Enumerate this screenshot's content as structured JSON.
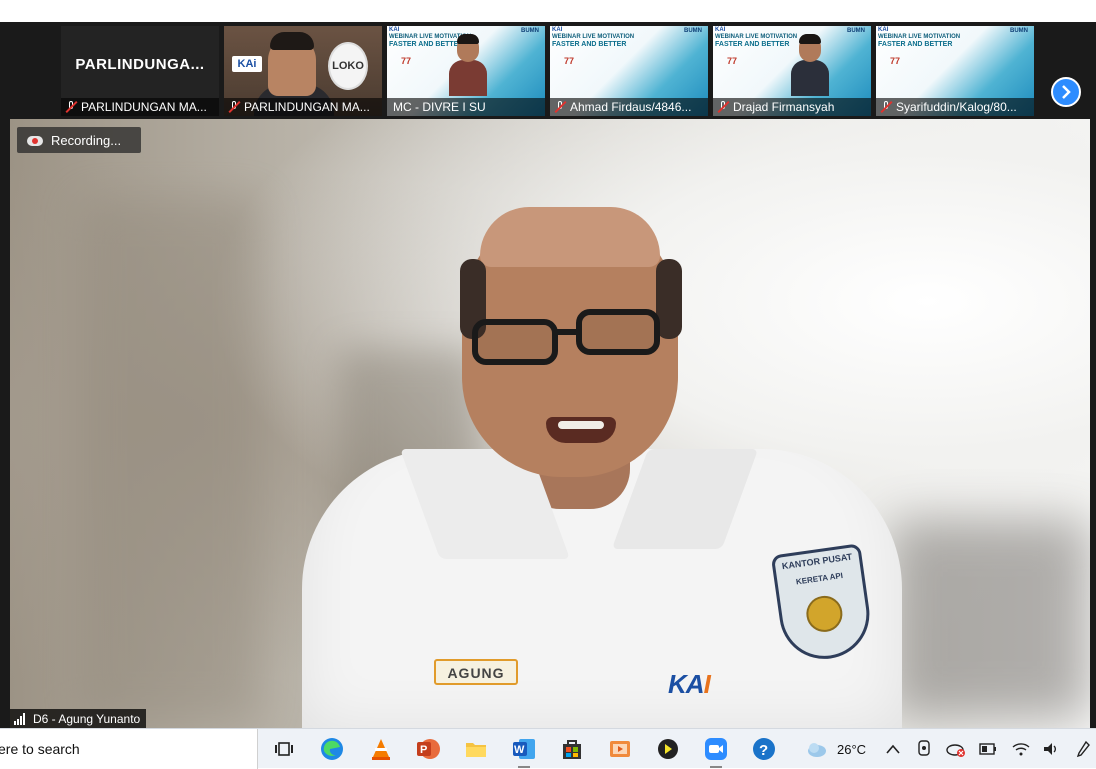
{
  "thumbnails": {
    "first_big_name": "PARLINDUNGA...",
    "items": [
      {
        "label": "PARLINDUNGAN MA..."
      },
      {
        "label": "PARLINDUNGAN MA..."
      },
      {
        "label": "MC - DIVRE I SU"
      },
      {
        "label": "Ahmad Firdaus/4846..."
      },
      {
        "label": "Drajad Firmansyah"
      },
      {
        "label": "Syarifuddin/Kalog/80..."
      }
    ],
    "slide_title_line1": "WEBINAR LIVE MOTIVATION",
    "slide_title_line2": "FASTER AND BETTER",
    "slide_bumn": "BUMN",
    "slide_kai": "KAI",
    "slide_77": "77",
    "cam_kai_sign": "KAi",
    "cam_loko_sign": "LOKO",
    "next_icon": "chevron-right-icon"
  },
  "main_video": {
    "recording_label": "Recording...",
    "participant_name": "D6 - Agung Yunanto",
    "name_tag": "AGUNG",
    "logo_text_k": "K",
    "logo_text_a": "A",
    "logo_text_i": "I",
    "badge_line1": "KANTOR PUSAT",
    "badge_line2": "KERETA API"
  },
  "taskbar": {
    "search_text": "ere to search",
    "weather": "26°C",
    "icons": [
      "task-view-icon",
      "edge-icon",
      "vlc-icon",
      "powerpoint-icon",
      "file-explorer-icon",
      "word-icon",
      "store-icon",
      "media-player-icon",
      "app-arrow-icon",
      "zoom-icon",
      "help-icon"
    ]
  }
}
